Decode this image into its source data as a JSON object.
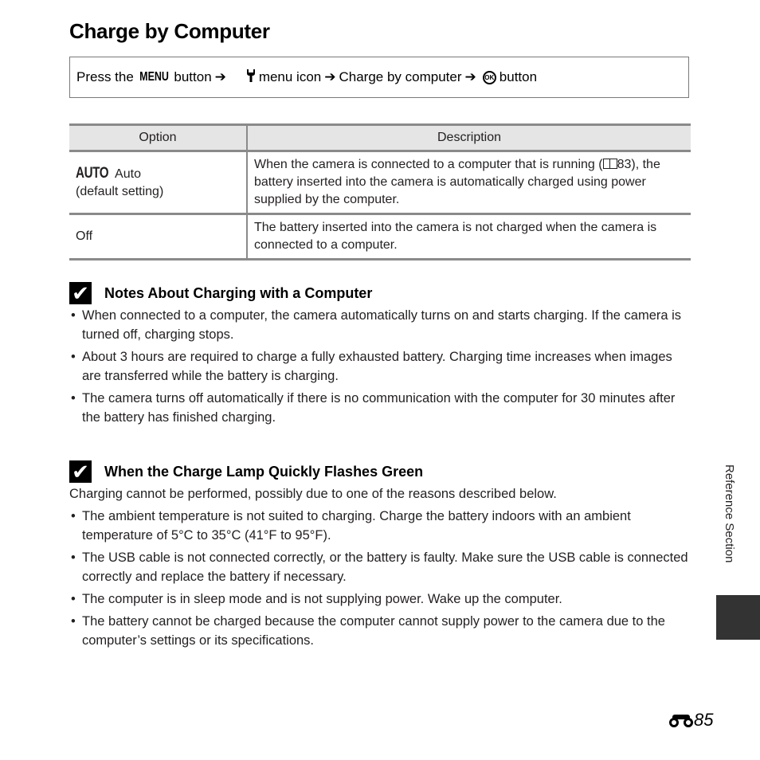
{
  "page": {
    "title": "Charge by Computer",
    "side_label": "Reference Section",
    "page_number": "85",
    "page_prefix_icon": "binoculars-icon"
  },
  "navigation": {
    "press_the": "Press the",
    "menu_key": "MENU",
    "button_word": "button",
    "arrow": "➔",
    "wrench_icon": "wrench-setup-icon",
    "menu_icon_text": "menu icon",
    "charge_by_computer": "Charge by computer",
    "ok_key": "OK",
    "button_word_end": "button"
  },
  "table": {
    "headers": [
      "Option",
      "Description"
    ],
    "rows": [
      {
        "option_icon": "AUTO",
        "option_label": "Auto",
        "option_note": "(default setting)",
        "description_line1_pre": "When the camera is connected to a computer that is running (",
        "description_ref_icon": "book-reference-icon",
        "description_ref_page": "83),",
        "description_rest": "the battery inserted into the camera is automatically charged using power supplied by the computer."
      },
      {
        "option_label": "Off",
        "description": "The battery inserted into the camera is not charged when the camera is connected to a computer."
      }
    ]
  },
  "notes": [
    {
      "icon": "checkmark-icon",
      "title": "Notes About Charging with a Computer",
      "intro": "",
      "bullets": [
        "When connected to a computer, the camera automatically turns on and starts charging. If the camera is turned off, charging stops.",
        "About 3 hours are required to charge a fully exhausted battery. Charging time increases when images are transferred while the battery is charging.",
        "The camera turns off automatically if there is no communication with the computer for 30 minutes after the battery has finished charging."
      ]
    },
    {
      "icon": "checkmark-icon",
      "title": "When the Charge Lamp Quickly Flashes Green",
      "intro": "Charging cannot be performed, possibly due to one of the reasons described below.",
      "bullets": [
        "The ambient temperature is not suited to charging. Charge the battery indoors with an ambient temperature of 5°C to 35°C (41°F to 95°F).",
        "The USB cable is not connected correctly, or the battery is faulty. Make sure the USB cable is connected correctly and replace the battery if necessary.",
        "The computer is in sleep mode and is not supplying power. Wake up the computer.",
        "The battery cannot be charged because the computer cannot supply power to the camera due to the computer’s settings or its specifications."
      ]
    }
  ],
  "colors": {
    "side_tab": "#333333",
    "table_header_bg": "#e5e5e5",
    "table_rule": "#8a8a8a"
  }
}
